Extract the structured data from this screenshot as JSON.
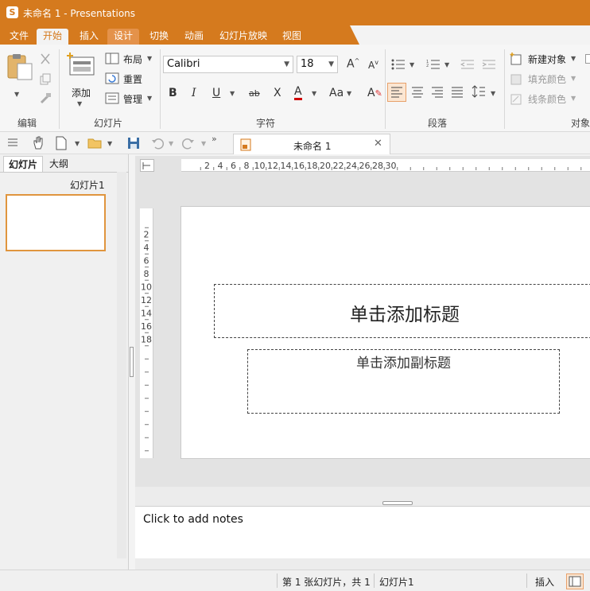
{
  "app": {
    "title": "未命名 1 - Presentations",
    "icon_letter": "S",
    "accent": "#d57a1e"
  },
  "menu": {
    "tabs": [
      "文件",
      "开始",
      "插入",
      "设计",
      "切换",
      "动画",
      "幻灯片放映",
      "视图"
    ],
    "active": "开始"
  },
  "ribbon": {
    "edit_group": "编辑",
    "slides_group": {
      "label": "幻灯片",
      "add": "添加",
      "layout": "布局",
      "reset": "重置",
      "manage": "管理"
    },
    "font_group": {
      "label": "字符",
      "font_name": "Calibri",
      "font_size": "18"
    },
    "paragraph_group": {
      "label": "段落"
    },
    "object_group": {
      "label": "对象",
      "new_object": "新建对象",
      "fill_color": "填充颜色",
      "line_color": "线条颜色"
    }
  },
  "document_tab": {
    "name": "未命名 1"
  },
  "left_panel": {
    "tabs": [
      "幻灯片",
      "大纲"
    ],
    "slide_label": "幻灯片1"
  },
  "rulers": {
    "horizontal": [
      "2",
      "4",
      "6",
      "8",
      "10",
      "12",
      "14",
      "16",
      "18",
      "20",
      "22",
      "24",
      "26",
      "28",
      "30"
    ],
    "vertical": [
      "2",
      "4",
      "6",
      "8",
      "10",
      "12",
      "14",
      "16",
      "18"
    ]
  },
  "slide": {
    "title_placeholder": "单击添加标题",
    "subtitle_placeholder": "单击添加副标题"
  },
  "notes": {
    "placeholder": "Click to add notes"
  },
  "status": {
    "slide_info": "第 1 张幻灯片，共 1",
    "slide_name": "幻灯片1",
    "mode": "插入"
  }
}
